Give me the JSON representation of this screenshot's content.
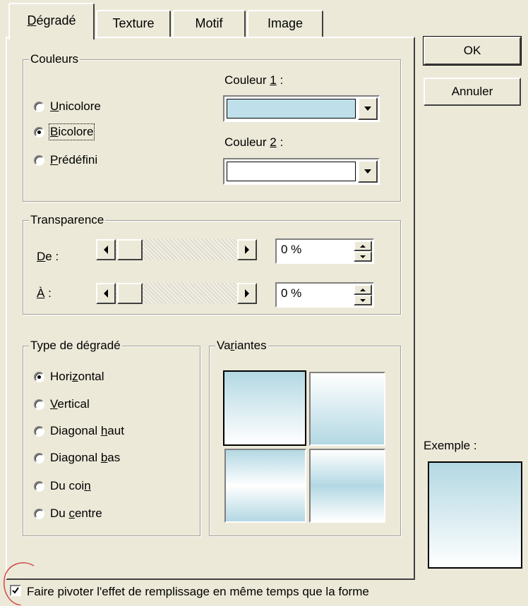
{
  "tabs": [
    {
      "label": "Dégradé",
      "underline_char": "D",
      "active": true
    },
    {
      "label": "Texture",
      "active": false
    },
    {
      "label": "Motif",
      "active": false
    },
    {
      "label": "Image",
      "active": false
    }
  ],
  "buttons": {
    "ok": "OK",
    "cancel": "Annuler"
  },
  "couleurs": {
    "legend": "Couleurs",
    "options": [
      {
        "pre": "",
        "u": "U",
        "post": "nicolore",
        "selected": false
      },
      {
        "pre": "",
        "u": "B",
        "post": "icolore",
        "selected": true
      },
      {
        "pre": "",
        "u": "P",
        "post": "rédéfini",
        "selected": false
      }
    ],
    "color1": {
      "pre": "Couleur ",
      "u": "1",
      "post": " :",
      "value": "#bfe0ea"
    },
    "color2": {
      "pre": "Couleur ",
      "u": "2",
      "post": " :",
      "value": "#ffffff"
    }
  },
  "transparence": {
    "legend": "Transparence",
    "from": {
      "u": "D",
      "post": "e :",
      "value": "0 %",
      "level": 0
    },
    "to": {
      "u": "À",
      "post": " :",
      "value": "0 %",
      "level": 0
    }
  },
  "type": {
    "legend": "Type de dégradé",
    "options": [
      {
        "pre": "Hori",
        "u": "z",
        "post": "ontal",
        "selected": true
      },
      {
        "pre": "",
        "u": "V",
        "post": "ertical",
        "selected": false
      },
      {
        "pre": "Diagonal ",
        "u": "h",
        "post": "aut",
        "selected": false
      },
      {
        "pre": "Diagonal ",
        "u": "b",
        "post": "as",
        "selected": false
      },
      {
        "pre": "Du coi",
        "u": "n",
        "post": "",
        "selected": false
      },
      {
        "pre": "Du ",
        "u": "c",
        "post": "entre",
        "selected": false
      }
    ]
  },
  "variantes": {
    "legend_pre": "Va",
    "legend_u": "r",
    "legend_post": "iantes"
  },
  "exemple": {
    "label": "Exemple :"
  },
  "rotate": {
    "pre": "Faire pivoter l'effet de remplissage en même temps que la forme",
    "checked": true
  },
  "colors": {
    "accent": "#bfe0ea",
    "dialog_bg": "#ece9d8"
  }
}
